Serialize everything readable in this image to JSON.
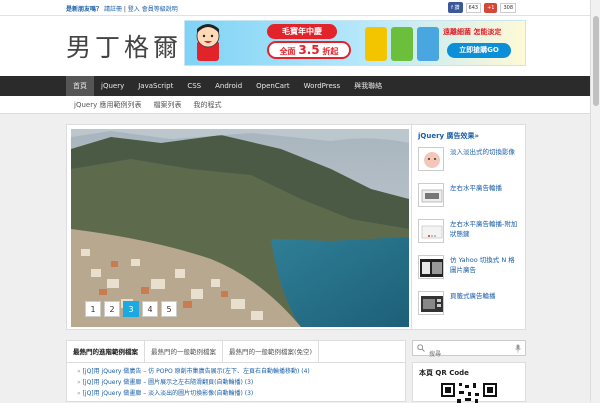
{
  "topbar": {
    "new_visitor": "是新朋友嗎？",
    "register": "請註冊",
    "separator": " | ",
    "login": "登入",
    "separator2": "   ",
    "member_features": "會員等級說明",
    "fb_label": "f 讚",
    "fb_count": "643",
    "gplus_label": "+1",
    "gplus_count": "308"
  },
  "header": {
    "logo": "男丁格爾",
    "banner": {
      "pill": "毛寶年中慶",
      "offer_prefix": "全面",
      "offer_num": "3.5",
      "offer_suffix": "折起",
      "slogan": "遠離細菌 怎能淡定",
      "buy": "立即搶購GO"
    }
  },
  "nav": {
    "items": [
      "首頁",
      "jQuery",
      "JavaScript",
      "CSS",
      "Android",
      "OpenCart",
      "WordPress",
      "與我聯絡"
    ],
    "active_index": 0
  },
  "subnav": {
    "items": [
      "jQuery 應用範例列表",
      "檔案列表",
      "我的程式"
    ]
  },
  "slider": {
    "pages": [
      "1",
      "2",
      "3",
      "4",
      "5"
    ],
    "active_page": 2
  },
  "ads": {
    "title": "jQuery 廣告效果»",
    "items": [
      {
        "label": "淡入淡出式的切換影像"
      },
      {
        "label": "左右水平廣告輪播"
      },
      {
        "label": "左右水平廣告輪播-附加狀態鍵"
      },
      {
        "label": "仿 Yahoo 切換式 N 格圖片廣告"
      },
      {
        "label": "頁籤式廣告輪播"
      }
    ]
  },
  "tabs": {
    "labels": [
      "最熱門的進階範例檔案",
      "最熱門的一般範例檔案",
      "最熱門的一般範例檔案(免空)"
    ],
    "active_index": 0,
    "list": [
      "[jQ]用 jQuery 做廣告 – 仿 POPO 原創市集廣告展示(左下、左頁右自動輪播移動) (4)",
      "[jQ]用 jQuery 做畫廊 – 圖片展示之左右隨滑翻頁(自動輪播) (3)",
      "[jQ]用 jQuery 做畫廊 – 淡入淡出的圖片切換影像(自動輪播) (3)"
    ]
  },
  "search": {
    "placeholder": "搜尋"
  },
  "qr": {
    "title": "本頁 QR Code"
  },
  "colors": {
    "link": "#1a5ea8",
    "nav_bg": "#2b2b2b",
    "active_dot": "#1aa9e1",
    "brand_red": "#e2232a"
  }
}
